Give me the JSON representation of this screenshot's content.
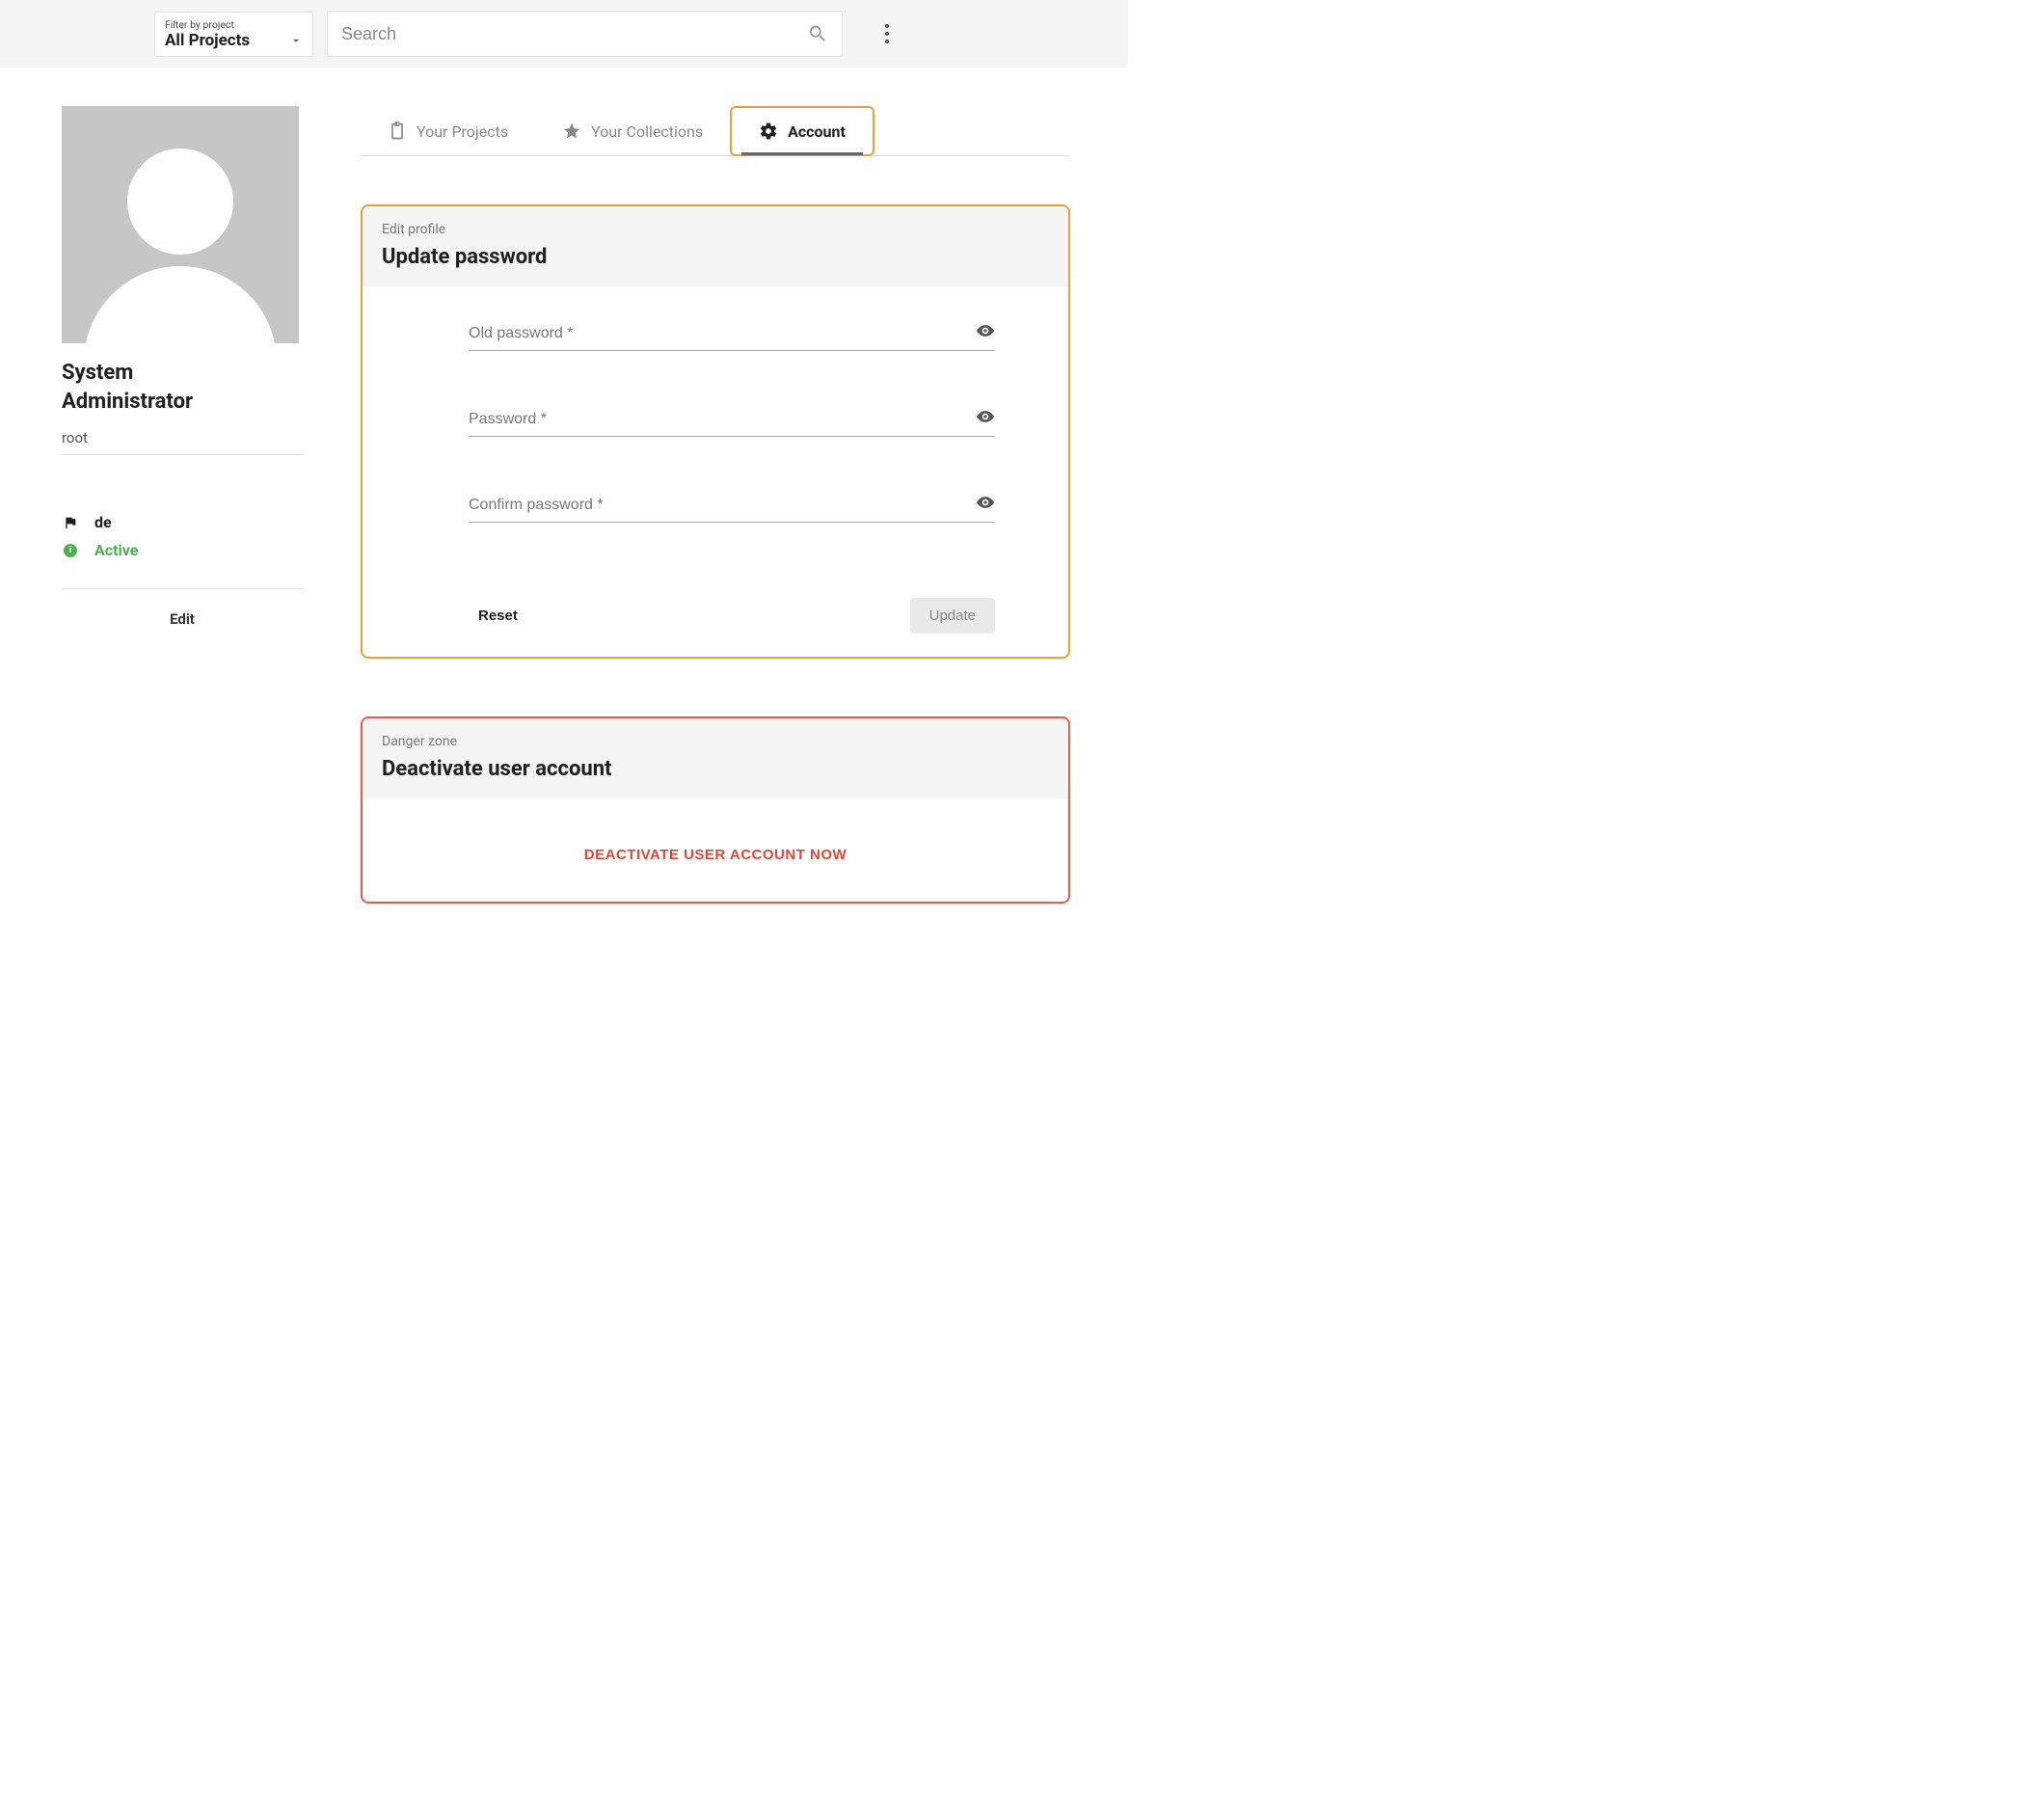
{
  "topbar": {
    "filter_label": "Filter by project",
    "filter_value": "All Projects",
    "search_placeholder": "Search"
  },
  "sidebar": {
    "display_name_line1": "System",
    "display_name_line2": "Administrator",
    "username": "root",
    "language": "de",
    "status": "Active",
    "edit": "Edit"
  },
  "tabs": {
    "projects": "Your Projects",
    "collections": "Your Collections",
    "account": "Account"
  },
  "password_panel": {
    "overline": "Edit profile",
    "title": "Update password",
    "old_placeholder": "Old password *",
    "new_placeholder": "Password *",
    "confirm_placeholder": "Confirm password *",
    "reset": "Reset",
    "update": "Update"
  },
  "danger_panel": {
    "overline": "Danger zone",
    "title": "Deactivate user account",
    "button": "DEACTIVATE USER ACCOUNT NOW"
  }
}
